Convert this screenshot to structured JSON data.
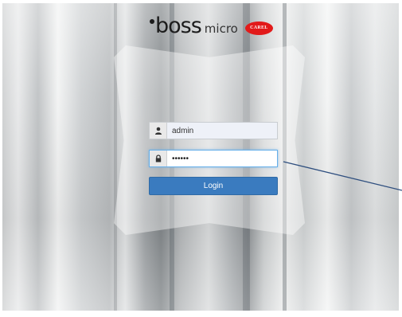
{
  "logo": {
    "brand": "boss",
    "sub": "micro",
    "badge": "CAREL"
  },
  "form": {
    "username_value": "admin",
    "password_value": "••••••",
    "login_label": "Login"
  },
  "icons": {
    "username": "user-icon",
    "password": "lock-icon"
  },
  "colors": {
    "login_button": "#3a7bbf",
    "brand_badge": "#e21a1a",
    "annotation_line": "#2f4f7f"
  }
}
